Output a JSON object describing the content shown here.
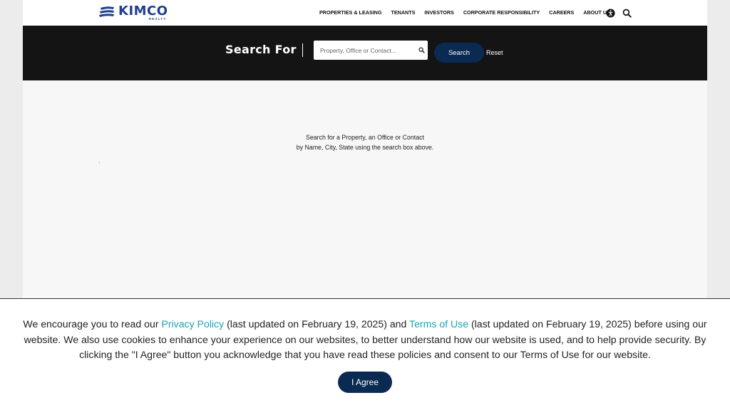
{
  "header": {
    "logo_text": "KIMCO",
    "logo_subtext": "REALTY",
    "nav": [
      {
        "label": "PROPERTIES & LEASING"
      },
      {
        "label": "TENANTS"
      },
      {
        "label": "INVESTORS"
      },
      {
        "label": "CORPORATE RESPONSIBILITY"
      },
      {
        "label": "CAREERS"
      },
      {
        "label": "ABOUT US"
      }
    ],
    "icons": [
      "accessibility-icon",
      "search-icon"
    ]
  },
  "search": {
    "title": "Search For",
    "placeholder": "Property, Office or Contact...",
    "value": "",
    "button_label": "Search",
    "reset_label": "Reset"
  },
  "main": {
    "hint_line1": "Search for a Property, an Office or Contact",
    "hint_line2": "by Name, City, State using the search box above."
  },
  "cookie": {
    "text_1": "We encourage you to read our ",
    "privacy_link": "Privacy Policy",
    "text_2": " (last updated on February 19, 2025) and ",
    "terms_link": "Terms of Use",
    "text_3": " (last updated on February 19, 2025) before using our website. We also use cookies to enhance your experience on our websites, to better understand how our website is used, and to help provide security. By clicking the \"I Agree\" button you acknowledge that you have read these policies and consent to our Terms of Use for our website.",
    "agree_label": "I Agree"
  },
  "colors": {
    "brand": "#1f3f8f",
    "button": "#0a2a52",
    "link": "#1ba3b8",
    "search_bar": "#141414"
  }
}
